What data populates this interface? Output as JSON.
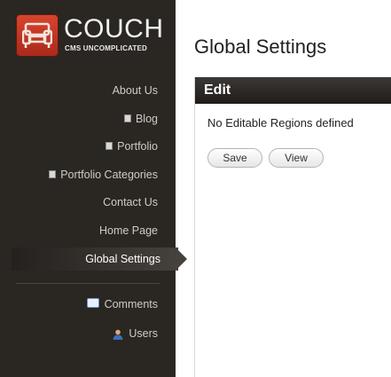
{
  "brand": {
    "title": "COUCH",
    "tagline": "CMS UNCOMPLICATED",
    "logo_icon": "couch-icon"
  },
  "sidebar": {
    "items": [
      {
        "label": "About Us",
        "icon": null
      },
      {
        "label": "Blog",
        "icon": "page-icon"
      },
      {
        "label": "Portfolio",
        "icon": "page-icon"
      },
      {
        "label": "Portfolio Categories",
        "icon": "page-icon"
      },
      {
        "label": "Contact Us",
        "icon": null
      },
      {
        "label": "Home Page",
        "icon": null
      },
      {
        "label": "Global Settings",
        "icon": null,
        "active": true
      }
    ],
    "active_chevron": "»",
    "bottom_items": [
      {
        "label": "Comments",
        "icon": "comment-icon"
      },
      {
        "label": "Users",
        "icon": "user-icon"
      }
    ]
  },
  "main": {
    "title": "Global Settings",
    "panel_header": "Edit",
    "message": "No Editable Regions defined",
    "buttons": {
      "save": "Save",
      "view": "View"
    }
  },
  "colors": {
    "sidebar_bg": "#2a2622",
    "logo_red": "#c23a24",
    "header_dark": "#1f1c1a",
    "nav_text": "#cfcbc6"
  }
}
